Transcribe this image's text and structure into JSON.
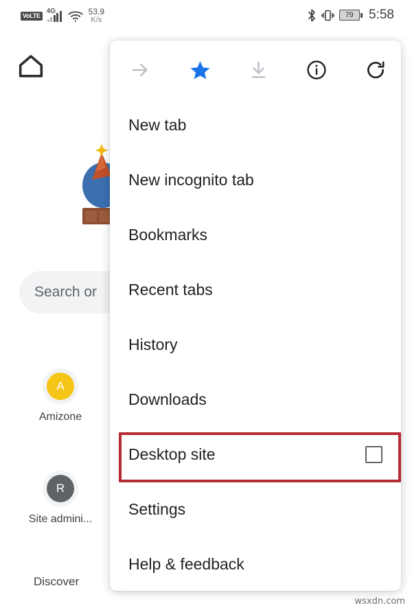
{
  "status_bar": {
    "volte_label": "VoLTE",
    "network_type": "4G",
    "signal_bars": 5,
    "wifi_icon": "wifi-icon",
    "data_speed_value": "53.9",
    "data_speed_unit": "K/s",
    "bluetooth_icon": "bluetooth-icon",
    "vibrate_icon": "vibrate-icon",
    "battery_percent": "79",
    "time": "5:58"
  },
  "new_tab_page": {
    "home_icon": "home-icon",
    "doodle_icon": "google-doodle-illustration",
    "search": {
      "placeholder": "Search or",
      "icon": "search-pill"
    },
    "shortcuts": [
      {
        "letter": "A",
        "label": "Amizone",
        "color": "#f5c518"
      },
      {
        "letter": "R",
        "label": "Site admini...",
        "color": "#5f6368"
      }
    ],
    "discover_label": "Discover"
  },
  "menu": {
    "header_buttons": [
      {
        "name": "forward-arrow-icon",
        "label": "Forward",
        "state": "disabled",
        "color": "#bdc1c6"
      },
      {
        "name": "star-filled-icon",
        "label": "Bookmark",
        "state": "active",
        "color": "#1a73e8"
      },
      {
        "name": "download-icon",
        "label": "Download",
        "state": "disabled",
        "color": "#bdc1c6"
      },
      {
        "name": "info-circle-icon",
        "label": "Page info",
        "state": "enabled",
        "color": "#202124"
      },
      {
        "name": "reload-icon",
        "label": "Reload",
        "state": "enabled",
        "color": "#202124"
      }
    ],
    "items": [
      {
        "label": "New tab",
        "type": "item"
      },
      {
        "label": "New incognito tab",
        "type": "item"
      },
      {
        "label": "Bookmarks",
        "type": "item"
      },
      {
        "label": "Recent tabs",
        "type": "item"
      },
      {
        "label": "History",
        "type": "item"
      },
      {
        "label": "Downloads",
        "type": "item"
      },
      {
        "label": "Desktop site",
        "type": "checkbox",
        "checked": false,
        "highlighted": true
      },
      {
        "label": "Settings",
        "type": "item"
      },
      {
        "label": "Help & feedback",
        "type": "item"
      }
    ],
    "highlight_color": "#b52b32"
  },
  "watermark": {
    "text": "wsxdn.com"
  }
}
